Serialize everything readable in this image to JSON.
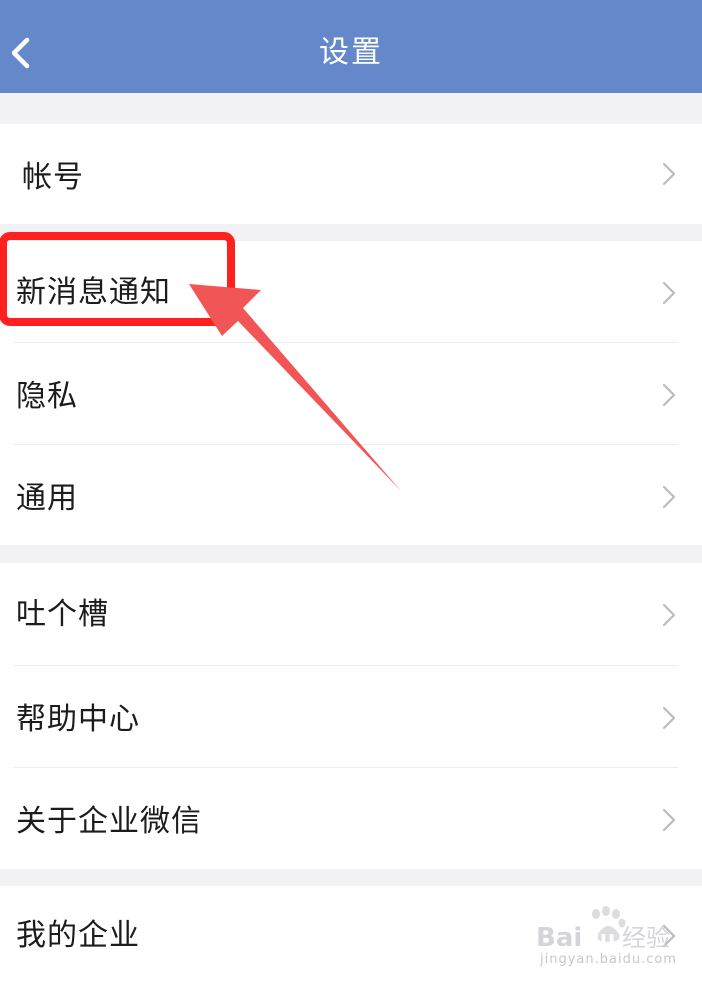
{
  "header": {
    "title": "设置",
    "background": "#6488c9"
  },
  "groups": [
    {
      "items": [
        {
          "label": "帐号"
        }
      ]
    },
    {
      "items": [
        {
          "label": "新消息通知"
        },
        {
          "label": "隐私"
        },
        {
          "label": "通用"
        }
      ]
    },
    {
      "items": [
        {
          "label": "吐个槽"
        },
        {
          "label": "帮助中心"
        },
        {
          "label": "关于企业微信"
        }
      ]
    },
    {
      "items": [
        {
          "label": "我的企业"
        }
      ]
    }
  ],
  "annotation": {
    "highlight_color": "#ff2020",
    "arrow_color": "#f25555"
  },
  "watermark": {
    "brand": "Baidu经验",
    "url": "jingyan.baidu.com"
  }
}
